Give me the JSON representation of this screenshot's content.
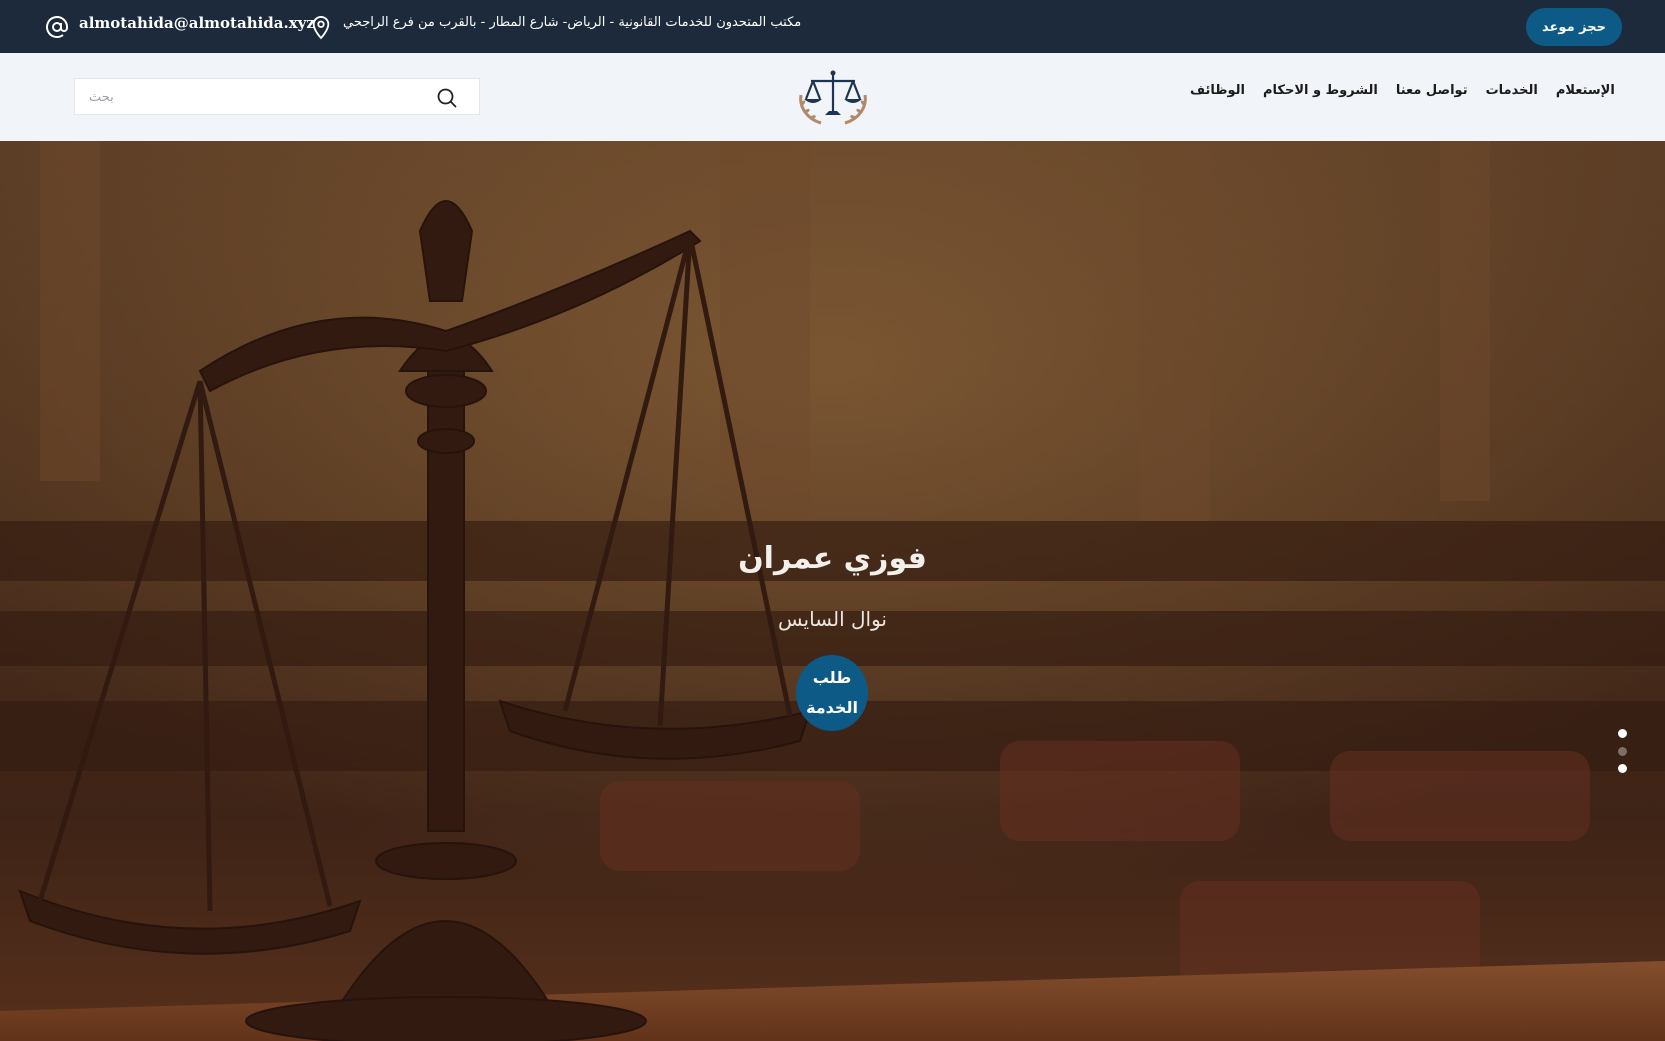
{
  "topbar": {
    "email": "almotahida@almotahida.xyz",
    "address": "مكتب المتحدون للخدمات القانونية - الرياض- شارع المطار - بالقرب من فرع الراجحي",
    "book_button": "حجز موعد",
    "icons": {
      "email": "at-sign-icon",
      "address": "map-pin-icon"
    }
  },
  "header": {
    "search_placeholder": "بحث",
    "logo": "scales-of-justice-logo",
    "nav": [
      "الوظائف",
      "الشروط و الاحكام",
      "تواصل معنا",
      "الخدمات",
      "الإستعلام"
    ]
  },
  "hero": {
    "title": "فوزي عمران",
    "subtitle": "نوال السايس",
    "cta_label": "طلب الخدمة",
    "slide_count": 3,
    "active_slide": 1
  },
  "colors": {
    "topbar_bg": "#1d2a3c",
    "accent": "#0d5a87",
    "header_bg": "#f1f4f8"
  }
}
